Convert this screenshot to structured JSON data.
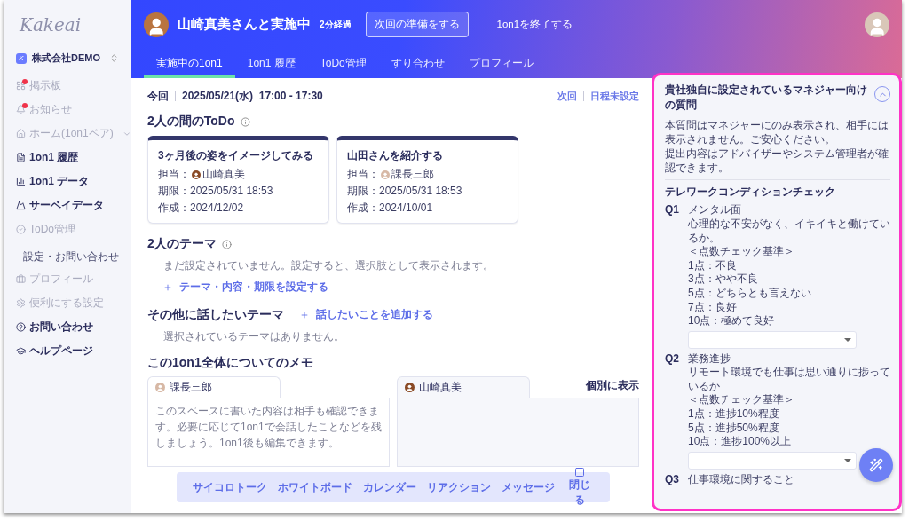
{
  "sidebar": {
    "logo": "Kakeai",
    "org": {
      "icon_letter": "K",
      "name": "株式会社DEMO"
    },
    "items": [
      {
        "label": "掲示板",
        "disabled": true,
        "badge": true
      },
      {
        "label": "お知らせ",
        "disabled": true,
        "badge": true
      },
      {
        "label": "ホーム(1on1ペア)",
        "disabled": true,
        "badge": false,
        "expanded": false
      },
      {
        "label": "1on1 履歴",
        "disabled": false,
        "badge": false
      },
      {
        "label": "1on1 データ",
        "disabled": false,
        "badge": false
      },
      {
        "label": "サーベイデータ",
        "disabled": false,
        "badge": false
      },
      {
        "label": "ToDo管理",
        "disabled": true,
        "badge": false
      }
    ],
    "section_title": "設定・お問い合わせ",
    "settings_items": [
      {
        "label": "プロフィール",
        "disabled": true
      },
      {
        "label": "便利にする設定",
        "disabled": true
      },
      {
        "label": "お問い合わせ",
        "disabled": false
      },
      {
        "label": "ヘルプページ",
        "disabled": false
      }
    ]
  },
  "header": {
    "title": "山崎真美さんと実施中",
    "elapsed": "2分経過",
    "prepare_button": "次回の準備をする",
    "end_link": "1on1を終了する",
    "tabs": [
      {
        "label": "実施中の1on1",
        "selected": true
      },
      {
        "label": "1on1 履歴",
        "selected": false
      },
      {
        "label": "ToDo管理",
        "selected": false
      },
      {
        "label": "すり合わせ",
        "selected": false
      },
      {
        "label": "プロフィール",
        "selected": false
      }
    ]
  },
  "schedule": {
    "current_label": "今回",
    "current_date": "2025/05/21(水)  17:00 - 17:30",
    "next_label": "次回",
    "next_value": "日程未設定"
  },
  "todo": {
    "title": "2人の間のToDo",
    "cards": [
      {
        "title": "3ヶ月後の姿をイメージしてみる",
        "assignee_label": "担当：",
        "assignee": "山崎真美",
        "due": "期限：2025/05/31 18:53",
        "created": "作成：2024/12/02"
      },
      {
        "title": "山田さんを紹介する",
        "assignee_label": "担当：",
        "assignee": "課長三郎",
        "due": "期限：2025/05/31 18:53",
        "created": "作成：2024/10/01"
      }
    ]
  },
  "themes": {
    "title": "2人のテーマ",
    "empty": "まだ設定されていません。設定すると、選択肢として表示されます。",
    "add": "テーマ・内容・期限を設定する"
  },
  "other_themes": {
    "title": "その他に話したいテーマ",
    "add": "話したいことを追加する",
    "empty": "選択されているテーマはありません。"
  },
  "memo": {
    "title": "この1on1全体についてのメモ",
    "individual": "個別に表示",
    "tabs": [
      {
        "name": "課長三郎",
        "placeholder": "このスペースに書いた内容は相手も確認できます。必要に応じて1on1で会話したことなどを残しましょう。1on1後も編集できます。"
      },
      {
        "name": "山崎真美"
      }
    ]
  },
  "toolbar": {
    "items": [
      "サイコロトーク",
      "ホワイトボード",
      "カレンダー",
      "リアクション",
      "メッセージ"
    ],
    "close": "閉じる"
  },
  "panel": {
    "title": "貴社独自に設定されているマネジャー向けの質問",
    "expanded": true,
    "notice": [
      "本質問はマネジャーにのみ表示され、相手には表示されません。ご安心ください。",
      "提出内容はアドバイザーやシステム管理者が確認できます。"
    ],
    "section": "テレワークコンディションチェック",
    "questions": [
      {
        "number": "Q1",
        "lines": [
          "メンタル面",
          "心理的な不安がなく、イキイキと働けているか。",
          "＜点数チェック基準＞",
          "1点：不良",
          "3点：やや不良",
          "5点：どちらとも言えない",
          "7点：良好",
          "10点：極めて良好"
        ],
        "has_dropdown": true
      },
      {
        "number": "Q2",
        "lines": [
          "業務進捗",
          "リモート環境でも仕事は思い通りに捗っているか",
          "＜点数チェック基準＞",
          "1点：進捗10%程度",
          "5点：進捗50%程度",
          "10点：進捗100%以上"
        ],
        "has_dropdown": true
      },
      {
        "number": "Q3",
        "lines": [
          "仕事環境に関すること"
        ],
        "has_dropdown": false
      }
    ]
  }
}
